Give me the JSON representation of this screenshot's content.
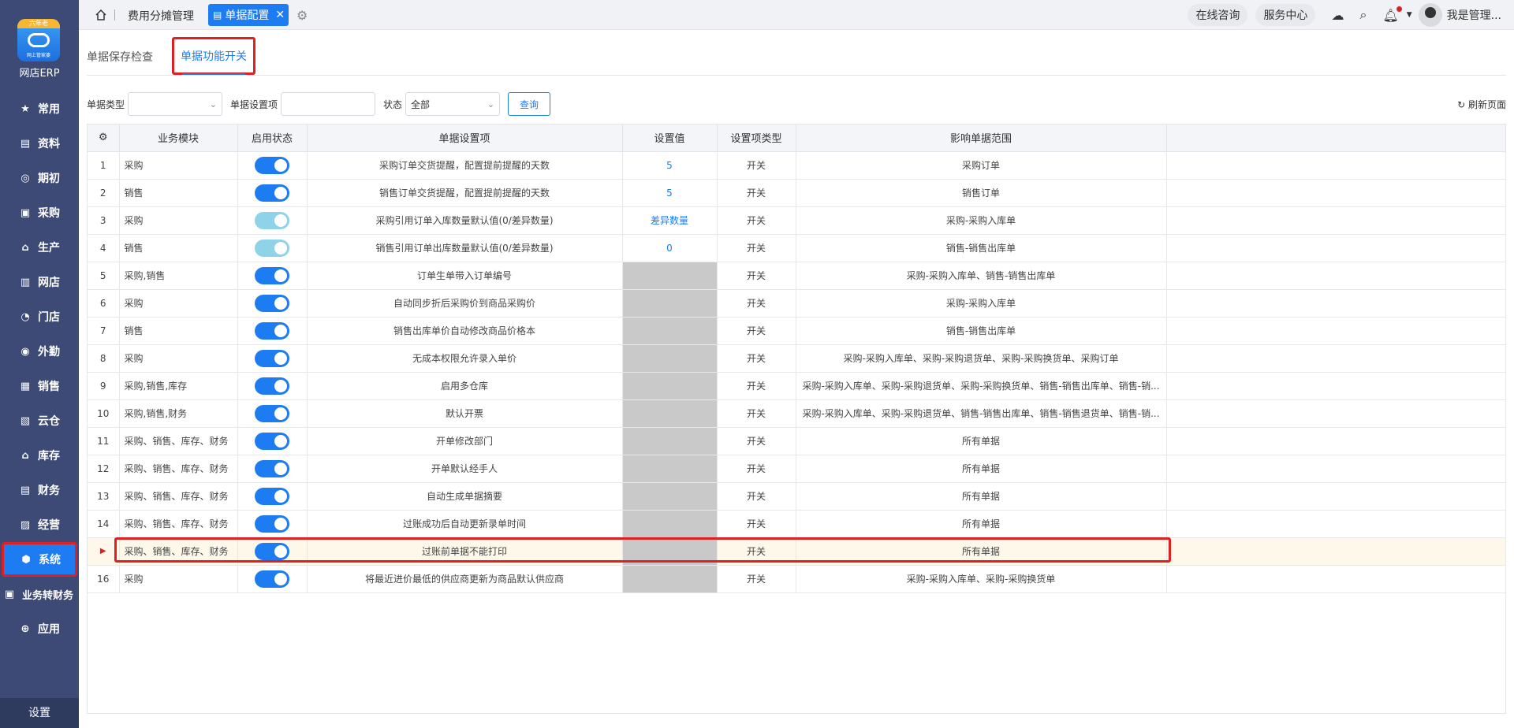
{
  "app": {
    "logo_ribbon": "六年老",
    "logo_caption": "网上管家婆",
    "name": "网店ERP"
  },
  "sidebar": {
    "items": [
      {
        "label": "常用",
        "icon": "star-icon"
      },
      {
        "label": "资料",
        "icon": "document-icon"
      },
      {
        "label": "期初",
        "icon": "target-icon"
      },
      {
        "label": "采购",
        "icon": "purchase-icon"
      },
      {
        "label": "生产",
        "icon": "factory-icon"
      },
      {
        "label": "网店",
        "icon": "store-icon"
      },
      {
        "label": "门店",
        "icon": "pie-icon"
      },
      {
        "label": "外勤",
        "icon": "field-icon"
      },
      {
        "label": "销售",
        "icon": "chart-icon"
      },
      {
        "label": "云仓",
        "icon": "cloud-warehouse-icon"
      },
      {
        "label": "库存",
        "icon": "warehouse-icon"
      },
      {
        "label": "财务",
        "icon": "finance-icon"
      },
      {
        "label": "经营",
        "icon": "business-icon"
      },
      {
        "label": "系统",
        "icon": "system-icon"
      },
      {
        "label": "业务转财务",
        "icon": "transfer-icon"
      },
      {
        "label": "应用",
        "icon": "app-icon"
      }
    ],
    "footer": "设置"
  },
  "topbar": {
    "tabs": [
      {
        "label": "费用分摊管理"
      },
      {
        "label": "单据配置"
      }
    ],
    "online_consult": "在线咨询",
    "service_center": "服务中心",
    "user_name": "我是管理..."
  },
  "subtabs": {
    "tab1": "单据保存检查",
    "tab2": "单据功能开关"
  },
  "filters": {
    "doc_type_label": "单据类型",
    "doc_type_value": "",
    "setting_label": "单据设置项",
    "status_label": "状态",
    "status_value": "全部",
    "query_button": "查询",
    "refresh": "刷新页面"
  },
  "table": {
    "headers": [
      "业务模块",
      "启用状态",
      "单据设置项",
      "设置值",
      "设置项类型",
      "影响单据范围"
    ],
    "rows": [
      {
        "no": "1",
        "module": "采购",
        "setting": "采购订单交货提醒，配置提前提醒的天数",
        "value": "5",
        "type": "开关",
        "scope": "采购订单"
      },
      {
        "no": "2",
        "module": "销售",
        "setting": "销售订单交货提醒，配置提前提醒的天数",
        "value": "5",
        "type": "开关",
        "scope": "销售订单"
      },
      {
        "no": "3",
        "module": "采购",
        "setting": "采购引用订单入库数量默认值(0/差异数量)",
        "value": "差异数量",
        "type": "开关",
        "scope": "采购-采购入库单"
      },
      {
        "no": "4",
        "module": "销售",
        "setting": "销售引用订单出库数量默认值(0/差异数量)",
        "value": "0",
        "type": "开关",
        "scope": "销售-销售出库单"
      },
      {
        "no": "5",
        "module": "采购,销售",
        "setting": "订单生单带入订单编号",
        "value": "",
        "type": "开关",
        "scope": "采购-采购入库单、销售-销售出库单"
      },
      {
        "no": "6",
        "module": "采购",
        "setting": "自动同步折后采购价到商品采购价",
        "value": "",
        "type": "开关",
        "scope": "采购-采购入库单"
      },
      {
        "no": "7",
        "module": "销售",
        "setting": "销售出库单价自动修改商品价格本",
        "value": "",
        "type": "开关",
        "scope": "销售-销售出库单"
      },
      {
        "no": "8",
        "module": "采购",
        "setting": "无成本权限允许录入单价",
        "value": "",
        "type": "开关",
        "scope": "采购-采购入库单、采购-采购退货单、采购-采购换货单、采购订单"
      },
      {
        "no": "9",
        "module": "采购,销售,库存",
        "setting": "启用多仓库",
        "value": "",
        "type": "开关",
        "scope": "采购-采购入库单、采购-采购退货单、采购-采购换货单、销售-销售出库单、销售-销..."
      },
      {
        "no": "10",
        "module": "采购,销售,财务",
        "setting": "默认开票",
        "value": "",
        "type": "开关",
        "scope": "采购-采购入库单、采购-采购退货单、销售-销售出库单、销售-销售退货单、销售-销..."
      },
      {
        "no": "11",
        "module": "采购、销售、库存、财务",
        "setting": "开单修改部门",
        "value": "",
        "type": "开关",
        "scope": "所有单据"
      },
      {
        "no": "12",
        "module": "采购、销售、库存、财务",
        "setting": "开单默认经手人",
        "value": "",
        "type": "开关",
        "scope": "所有单据"
      },
      {
        "no": "13",
        "module": "采购、销售、库存、财务",
        "setting": "自动生成单据摘要",
        "value": "",
        "type": "开关",
        "scope": "所有单据"
      },
      {
        "no": "14",
        "module": "采购、销售、库存、财务",
        "setting": "过账成功后自动更新录单时间",
        "value": "",
        "type": "开关",
        "scope": "所有单据"
      },
      {
        "no": "▶",
        "module": "采购、销售、库存、财务",
        "setting": "过账前单据不能打印",
        "value": "",
        "type": "开关",
        "scope": "所有单据"
      },
      {
        "no": "16",
        "module": "采购",
        "setting": "将最近进价最低的供应商更新为商品默认供应商",
        "value": "",
        "type": "开关",
        "scope": "采购-采购入库单、采购-采购换货单"
      }
    ]
  },
  "colors": {
    "accent": "#1e7cf2",
    "sidebar": "#3d4a75",
    "highlight_border": "#e02020"
  }
}
